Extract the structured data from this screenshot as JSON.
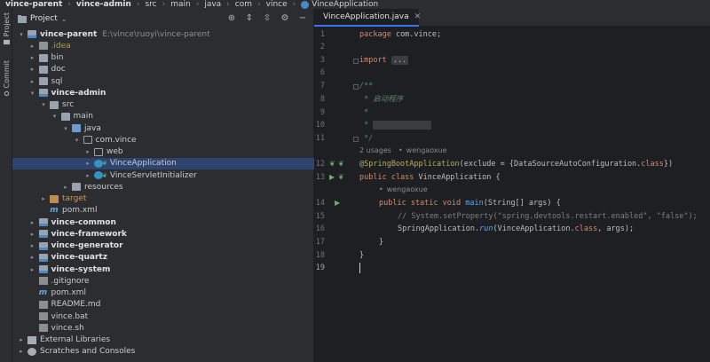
{
  "breadcrumb": [
    "vince-parent",
    "vince-admin",
    "src",
    "main",
    "java",
    "com",
    "vince",
    "VinceApplication"
  ],
  "leftstrip": {
    "project_label": "Project",
    "commit_label": "Commit"
  },
  "project_panel": {
    "title": "Project",
    "tree": [
      {
        "label": "vince-parent",
        "extra": "E:\\vince\\ruoyi\\vince-parent",
        "icon": "module-folder-icon",
        "depth": 0,
        "open": true,
        "bold": true
      },
      {
        "label": ".idea",
        "icon": "folder-icon",
        "depth": 1,
        "open": false,
        "style": "idea"
      },
      {
        "label": "bin",
        "icon": "folder-icon",
        "depth": 1,
        "open": false
      },
      {
        "label": "doc",
        "icon": "folder-icon",
        "depth": 1,
        "open": false
      },
      {
        "label": "sql",
        "icon": "folder-icon",
        "depth": 1,
        "open": false
      },
      {
        "label": "vince-admin",
        "icon": "module-folder-icon",
        "depth": 1,
        "open": true,
        "bold": true
      },
      {
        "label": "src",
        "icon": "folder-icon",
        "depth": 2,
        "open": true
      },
      {
        "label": "main",
        "icon": "folder-icon",
        "depth": 3,
        "open": true
      },
      {
        "label": "java",
        "icon": "source-folder-icon",
        "depth": 4,
        "open": true
      },
      {
        "label": "com.vince",
        "icon": "package-icon",
        "depth": 5,
        "open": true
      },
      {
        "label": "web",
        "icon": "package-icon",
        "depth": 6,
        "open": false
      },
      {
        "label": "VinceApplication",
        "icon": "spring-class-icon",
        "depth": 6,
        "open": false,
        "selected": true
      },
      {
        "label": "VinceServletInitializer",
        "icon": "spring-class-icon",
        "depth": 6,
        "open": false
      },
      {
        "label": "resources",
        "icon": "folder-icon",
        "depth": 4,
        "open": false
      },
      {
        "label": "target",
        "icon": "orange-folder-icon",
        "depth": 2,
        "open": false,
        "style": "orange"
      },
      {
        "label": "pom.xml",
        "icon": "maven-icon",
        "depth": 2,
        "leaf": true
      },
      {
        "label": "vince-common",
        "icon": "module-folder-icon",
        "depth": 1,
        "open": false,
        "bold": true
      },
      {
        "label": "vince-framework",
        "icon": "module-folder-icon",
        "depth": 1,
        "open": false,
        "bold": true
      },
      {
        "label": "vince-generator",
        "icon": "module-folder-icon",
        "depth": 1,
        "open": false,
        "bold": true
      },
      {
        "label": "vince-quartz",
        "icon": "module-folder-icon",
        "depth": 1,
        "open": false,
        "bold": true
      },
      {
        "label": "vince-system",
        "icon": "module-folder-icon",
        "depth": 1,
        "open": false,
        "bold": true
      },
      {
        "label": ".gitignore",
        "icon": "text-file-icon",
        "depth": 1,
        "leaf": true
      },
      {
        "label": "pom.xml",
        "icon": "maven-icon",
        "depth": 1,
        "leaf": true
      },
      {
        "label": "README.md",
        "icon": "markdown-file-icon",
        "depth": 1,
        "leaf": true
      },
      {
        "label": "vince.bat",
        "icon": "text-file-icon",
        "depth": 1,
        "leaf": true
      },
      {
        "label": "vince.sh",
        "icon": "text-file-icon",
        "depth": 1,
        "leaf": true
      },
      {
        "label": "External Libraries",
        "icon": "library-icon",
        "depth": 0,
        "open": false
      },
      {
        "label": "Scratches and Consoles",
        "icon": "scratches-icon",
        "depth": 0,
        "open": false
      }
    ]
  },
  "editor": {
    "tab_label": "VinceApplication.java",
    "line_numbers": [
      "1",
      "2",
      "3",
      "6",
      "7",
      "8",
      "9",
      "10",
      "11",
      "12",
      "13",
      "14",
      "15",
      "16",
      "17",
      "18",
      "19"
    ],
    "code": {
      "l1_kw": "package",
      "l1_rest": " com.vince;",
      "l3_kw": "import",
      "l3_collapsed": "...",
      "l7": "/**",
      "l8": " * 启动程序",
      "l9": " *",
      "l10": " * ",
      "l11": " */",
      "hint1_usages": "2 usages",
      "hint1_author": "wengaoxue",
      "l12_ann": "@SpringBootApplication",
      "l12_rest1": "(exclude = {DataSourceAutoConfiguration.",
      "l12_kw": "class",
      "l12_rest2": "})",
      "l13_kw": "public class",
      "l13_rest": " VinceApplication {",
      "hint2_author": "wengaoxue",
      "l14_kw": "public static void",
      "l14_fn": "main",
      "l14_rest": "(String[] args) {",
      "l15": "// System.setProperty(\"spring.devtools.restart.enabled\", \"false\");",
      "l16_cls": "SpringApplication.",
      "l16_fn": "run",
      "l16_mid": "(VinceApplication.",
      "l16_kw": "class",
      "l16_rest": ", args);",
      "l17": "}",
      "l18": "}"
    }
  }
}
